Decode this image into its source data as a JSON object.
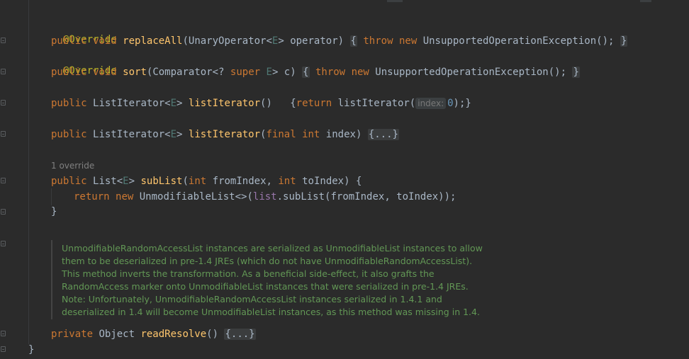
{
  "editor": {
    "lines": {
      "l1": {
        "annotation": "@Override"
      },
      "l2": {
        "kw1": "public",
        "kw2": "void",
        "method": "replaceAll",
        "p1": "(UnaryOperator<",
        "type_e": "E",
        "p2": "> operator) ",
        "brace_open": "{",
        "kw_throw": "throw",
        "kw_new": "new",
        "exc": "UnsupportedOperationException();",
        "brace_close": "}"
      },
      "l3": {
        "annotation": "@Override"
      },
      "l4": {
        "kw1": "public",
        "kw2": "void",
        "method": "sort",
        "p1": "(Comparator<? ",
        "kw_super": "super",
        "type_e": "E",
        "p2": "> c) ",
        "brace_open": "{",
        "kw_throw": "throw",
        "kw_new": "new",
        "exc": "UnsupportedOperationException();",
        "brace_close": "}"
      },
      "l5": {
        "kw1": "public",
        "t1": "ListIterator<",
        "type_e": "E",
        "t2": "> ",
        "method": "listIterator",
        "p1": "()",
        "p2": "{",
        "kw_return": "return",
        "call": "listIterator(",
        "hint": "index:",
        "num": "0",
        "end": ");}"
      },
      "l6": {
        "kw1": "public",
        "t1": "ListIterator<",
        "type_e": "E",
        "t2": "> ",
        "method": "listIterator",
        "p1": "(",
        "kw_final": "final",
        "kw_int": "int",
        "p2": " index) ",
        "folded": "{...}"
      },
      "override_hint": "1 override",
      "l7": {
        "kw1": "public",
        "t1": "List<",
        "type_e": "E",
        "t2": "> ",
        "method": "subList",
        "p1": "(",
        "kw_int1": "int",
        "p2": " fromIndex, ",
        "kw_int2": "int",
        "p3": " toIndex) {"
      },
      "l8": {
        "kw_return": "return",
        "kw_new": "new",
        "p1": " UnmodifiableList<>(",
        "field": "list",
        "p2": ".subList(fromIndex, toIndex));"
      },
      "l9": {
        "text": "}"
      },
      "l10": {
        "kw1": "private",
        "p1": " Object ",
        "method": "readResolve",
        "p2": "() ",
        "folded": "{...}"
      },
      "l11": {
        "text": "}"
      }
    },
    "doc_comment": [
      "UnmodifiableRandomAccessList instances are serialized as UnmodifiableList instances to allow",
      "them to be deserialized in pre-1.4 JREs (which do not have UnmodifiableRandomAccessList).",
      "This method inverts the transformation. As a beneficial side-effect, it also grafts the",
      "RandomAccess marker onto UnmodifiableList instances that were serialized in pre-1.4 JREs.",
      "Note: Unfortunately, UnmodifiableRandomAccessList instances serialized in 1.4.1 and",
      "deserialized in 1.4 will become UnmodifiableList instances, as this method was missing in 1.4."
    ],
    "colors": {
      "background": "#2b2b2b",
      "keyword": "#cc7832",
      "annotation": "#bbb529",
      "method": "#ffc66d",
      "doc": "#629755",
      "number": "#6897bb"
    }
  }
}
